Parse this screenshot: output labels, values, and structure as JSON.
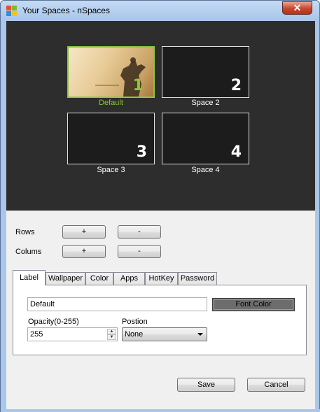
{
  "window": {
    "title": "Your Spaces - nSpaces",
    "close_glyph": "✕"
  },
  "spaces": [
    {
      "number": "1",
      "label": "Default"
    },
    {
      "number": "2",
      "label": "Space 2"
    },
    {
      "number": "3",
      "label": "Space 3"
    },
    {
      "number": "4",
      "label": "Space 4"
    }
  ],
  "layout_controls": {
    "rows_label": "Rows",
    "columns_label": "Colums",
    "add_label": "+",
    "remove_label": "-"
  },
  "tabs": [
    "Label",
    "Wallpaper",
    "Color",
    "Apps",
    "HotKey",
    "Password"
  ],
  "selected_tab": "Label",
  "label_tab": {
    "label_value": "Default",
    "font_color_button": "Font Color",
    "opacity_label": "Opacity(0-255)",
    "opacity_value": "255",
    "position_label": "Postion",
    "position_value": "None"
  },
  "footer": {
    "save_label": "Save",
    "cancel_label": "Cancel"
  },
  "colors": {
    "active_accent": "#8cc63f",
    "preview_background": "#2d2d2d",
    "font_color_swatch": "#6d6d6d"
  }
}
